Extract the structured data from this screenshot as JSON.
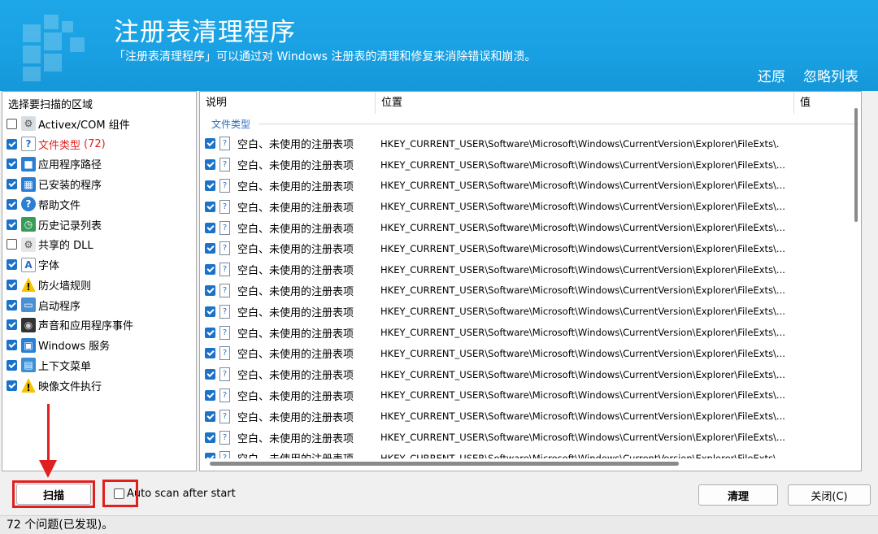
{
  "header": {
    "title": "注册表清理程序",
    "subtitle": "「注册表清理程序」可以通过对 Windows 注册表的清理和修复来消除错误和崩溃。",
    "restore_link": "还原",
    "ignore_list_link": "忽略列表"
  },
  "areas": {
    "title": "选择要扫描的区域",
    "items": [
      {
        "label": "Activex/COM 组件",
        "checked": false,
        "icon": "activex-icon"
      },
      {
        "label": "文件类型",
        "count": "(72)",
        "checked": true,
        "icon": "file-type-icon",
        "highlight": "#e02020"
      },
      {
        "label": "应用程序路径",
        "checked": true,
        "icon": "app-path-icon"
      },
      {
        "label": "已安装的程序",
        "checked": true,
        "icon": "installed-programs-icon"
      },
      {
        "label": "帮助文件",
        "checked": true,
        "icon": "help-icon"
      },
      {
        "label": "历史记录列表",
        "checked": true,
        "icon": "history-icon"
      },
      {
        "label": "共享的 DLL",
        "checked": false,
        "icon": "shared-dll-icon"
      },
      {
        "label": "字体",
        "checked": true,
        "icon": "font-icon"
      },
      {
        "label": "防火墙规则",
        "checked": true,
        "icon": "firewall-warning-icon"
      },
      {
        "label": "启动程序",
        "checked": true,
        "icon": "startup-icon"
      },
      {
        "label": "声音和应用程序事件",
        "checked": true,
        "icon": "sound-icon"
      },
      {
        "label": "Windows 服务",
        "checked": true,
        "icon": "windows-service-icon"
      },
      {
        "label": "上下文菜单",
        "checked": true,
        "icon": "context-menu-icon"
      },
      {
        "label": "映像文件执行",
        "checked": true,
        "icon": "image-exec-warning-icon"
      }
    ]
  },
  "results": {
    "columns": [
      "说明",
      "位置",
      "值"
    ],
    "group_label": "文件类型",
    "rows": [
      {
        "desc": "空白、未使用的注册表项",
        "location": "HKEY_CURRENT_USER\\Software\\Microsoft\\Windows\\CurrentVersion\\Explorer\\FileExts\\.",
        "checked": true
      },
      {
        "desc": "空白、未使用的注册表项",
        "location": "HKEY_CURRENT_USER\\Software\\Microsoft\\Windows\\CurrentVersion\\Explorer\\FileExts\\...",
        "checked": true
      },
      {
        "desc": "空白、未使用的注册表项",
        "location": "HKEY_CURRENT_USER\\Software\\Microsoft\\Windows\\CurrentVersion\\Explorer\\FileExts\\...",
        "checked": true
      },
      {
        "desc": "空白、未使用的注册表项",
        "location": "HKEY_CURRENT_USER\\Software\\Microsoft\\Windows\\CurrentVersion\\Explorer\\FileExts\\...",
        "checked": true
      },
      {
        "desc": "空白、未使用的注册表项",
        "location": "HKEY_CURRENT_USER\\Software\\Microsoft\\Windows\\CurrentVersion\\Explorer\\FileExts\\...",
        "checked": true
      },
      {
        "desc": "空白、未使用的注册表项",
        "location": "HKEY_CURRENT_USER\\Software\\Microsoft\\Windows\\CurrentVersion\\Explorer\\FileExts\\...",
        "checked": true
      },
      {
        "desc": "空白、未使用的注册表项",
        "location": "HKEY_CURRENT_USER\\Software\\Microsoft\\Windows\\CurrentVersion\\Explorer\\FileExts\\...",
        "checked": true
      },
      {
        "desc": "空白、未使用的注册表项",
        "location": "HKEY_CURRENT_USER\\Software\\Microsoft\\Windows\\CurrentVersion\\Explorer\\FileExts\\...",
        "checked": true
      },
      {
        "desc": "空白、未使用的注册表项",
        "location": "HKEY_CURRENT_USER\\Software\\Microsoft\\Windows\\CurrentVersion\\Explorer\\FileExts\\...",
        "checked": true
      },
      {
        "desc": "空白、未使用的注册表项",
        "location": "HKEY_CURRENT_USER\\Software\\Microsoft\\Windows\\CurrentVersion\\Explorer\\FileExts\\...",
        "checked": true
      },
      {
        "desc": "空白、未使用的注册表项",
        "location": "HKEY_CURRENT_USER\\Software\\Microsoft\\Windows\\CurrentVersion\\Explorer\\FileExts\\...",
        "checked": true
      },
      {
        "desc": "空白、未使用的注册表项",
        "location": "HKEY_CURRENT_USER\\Software\\Microsoft\\Windows\\CurrentVersion\\Explorer\\FileExts\\...",
        "checked": true
      },
      {
        "desc": "空白、未使用的注册表项",
        "location": "HKEY_CURRENT_USER\\Software\\Microsoft\\Windows\\CurrentVersion\\Explorer\\FileExts\\...",
        "checked": true
      },
      {
        "desc": "空白、未使用的注册表项",
        "location": "HKEY_CURRENT_USER\\Software\\Microsoft\\Windows\\CurrentVersion\\Explorer\\FileExts\\...",
        "checked": true
      },
      {
        "desc": "空白、未使用的注册表项",
        "location": "HKEY_CURRENT_USER\\Software\\Microsoft\\Windows\\CurrentVersion\\Explorer\\FileExts\\...",
        "checked": true
      },
      {
        "desc": "空白、未使用的注册表项",
        "location": "HKEY_CURRENT_USER\\Software\\Microsoft\\Windows\\CurrentVersion\\Explorer\\FileExts\\...",
        "checked": true
      }
    ]
  },
  "bottom": {
    "scan_label": "扫描",
    "auto_scan_label": "Auto scan after start",
    "auto_scan_checked": false,
    "clean_label": "清理",
    "close_label": "关闭(C)"
  },
  "status": {
    "count": "72",
    "text": "个问题(已发现)。"
  },
  "colors": {
    "header_bg": "#1ea7e8",
    "checkbox_on": "#1a73c9",
    "highlight_red": "#e02020",
    "group_label": "#2a6fc0"
  }
}
